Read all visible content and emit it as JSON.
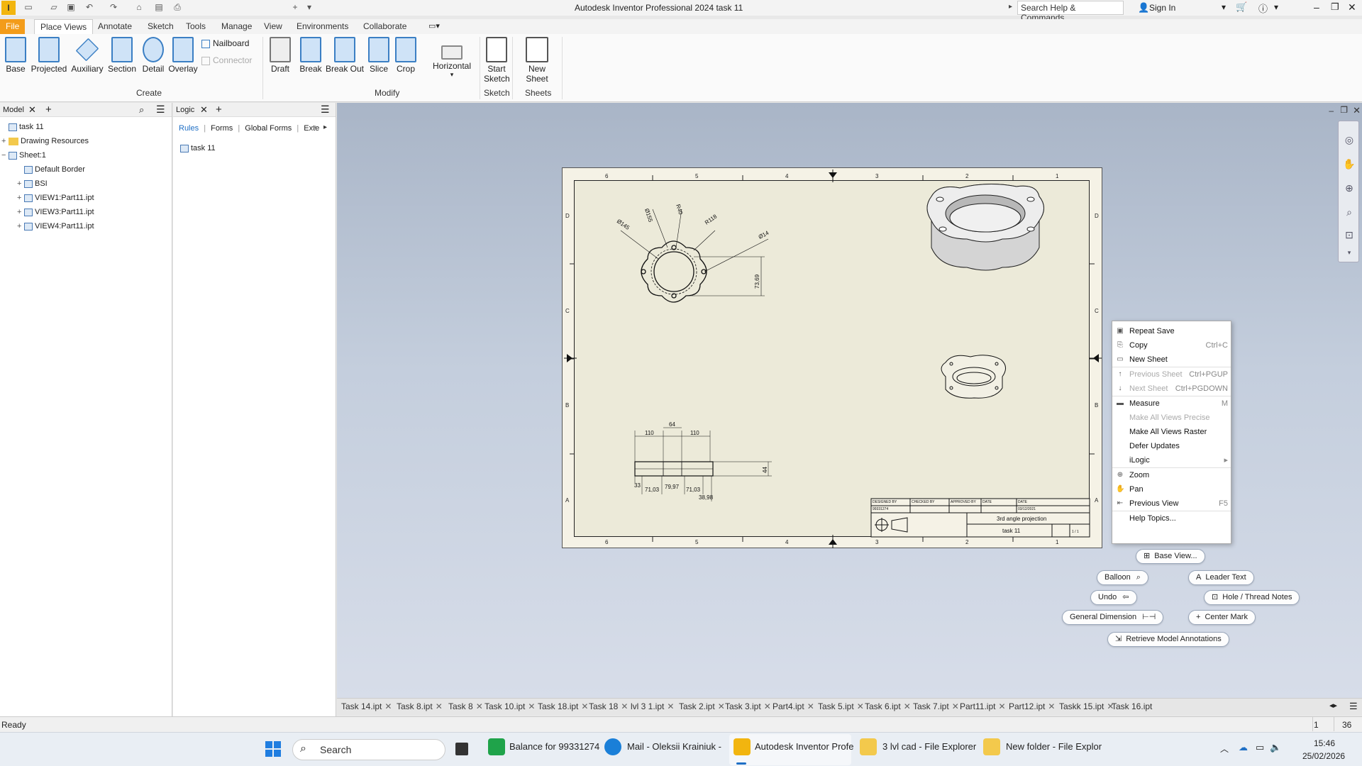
{
  "window": {
    "title": "Autodesk Inventor Professional 2024   task 11",
    "search_placeholder": "Search Help & Commands...",
    "sign_in": "Sign In"
  },
  "ribbon": {
    "tabs": [
      "File",
      "Place Views",
      "Annotate",
      "Sketch",
      "Tools",
      "Manage",
      "View",
      "Environments",
      "Collaborate"
    ],
    "active_tab": "Place Views",
    "create": {
      "label": "Create",
      "buttons": [
        "Base",
        "Projected",
        "Auxiliary",
        "Section",
        "Detail",
        "Overlay"
      ],
      "small": [
        "Nailboard",
        "Connector"
      ]
    },
    "modify": {
      "label": "Modify",
      "buttons": [
        "Draft",
        "Break",
        "Break Out",
        "Slice",
        "Crop",
        "Horizontal"
      ]
    },
    "sketch": {
      "label": "Sketch",
      "button": "Start Sketch"
    },
    "sheets": {
      "label": "Sheets",
      "button": "New Sheet"
    }
  },
  "model_browser": {
    "tab": "Model",
    "items": [
      {
        "label": "task 11",
        "indent": 0,
        "exp": ""
      },
      {
        "label": "Drawing Resources",
        "indent": 0,
        "exp": "+"
      },
      {
        "label": "Sheet:1",
        "indent": 0,
        "exp": "−"
      },
      {
        "label": "Default Border",
        "indent": 1,
        "exp": ""
      },
      {
        "label": "BSI",
        "indent": 1,
        "exp": "+"
      },
      {
        "label": "VIEW1:Part11.ipt",
        "indent": 1,
        "exp": "+"
      },
      {
        "label": "VIEW3:Part11.ipt",
        "indent": 1,
        "exp": "+"
      },
      {
        "label": "VIEW4:Part11.ipt",
        "indent": 1,
        "exp": "+"
      }
    ]
  },
  "logic_browser": {
    "tab": "Logic",
    "subtabs": [
      "Rules",
      "Forms",
      "Global Forms",
      "Exte"
    ],
    "items": [
      "task 11"
    ]
  },
  "drawing": {
    "col_labels": [
      "6",
      "5",
      "4",
      "3",
      "2",
      "1"
    ],
    "row_labels": [
      "D",
      "C",
      "B",
      "A"
    ],
    "dims_top": [
      "Ø155",
      "R40",
      "R118",
      "Ø145",
      "Ø14",
      "73,69"
    ],
    "dims_front": [
      "110",
      "64",
      "110",
      "33",
      "71,03",
      "79,97",
      "71,03",
      "38,98",
      "44"
    ],
    "title_block": {
      "projection": "3rd angle projection",
      "name": "task 11",
      "date": "03/12/2021",
      "sheet": "1 / 1",
      "drawn": "99331274",
      "headers": [
        "DESIGNED BY",
        "CHECKED BY",
        "APPROVED BY",
        "DATE",
        "DATE"
      ]
    }
  },
  "context_menu": {
    "items": [
      {
        "label": "Repeat Save",
        "shortcut": "",
        "disabled": false,
        "icon": "save-icon"
      },
      {
        "label": "Copy",
        "shortcut": "Ctrl+C",
        "disabled": false,
        "icon": "copy-icon"
      },
      {
        "label": "New Sheet",
        "shortcut": "",
        "disabled": false,
        "icon": "new-sheet-icon"
      },
      {
        "label": "Previous Sheet",
        "shortcut": "Ctrl+PGUP",
        "disabled": true,
        "icon": "arrow-up-icon"
      },
      {
        "label": "Next Sheet",
        "shortcut": "Ctrl+PGDOWN",
        "disabled": true,
        "icon": "arrow-down-icon"
      },
      {
        "label": "Measure",
        "shortcut": "M",
        "disabled": false,
        "icon": "measure-icon"
      },
      {
        "label": "Make All Views Precise",
        "shortcut": "",
        "disabled": true,
        "icon": ""
      },
      {
        "label": "Make All Views Raster",
        "shortcut": "",
        "disabled": false,
        "icon": ""
      },
      {
        "label": "Defer Updates",
        "shortcut": "",
        "disabled": false,
        "icon": ""
      },
      {
        "label": "iLogic",
        "shortcut": "▸",
        "disabled": false,
        "icon": ""
      },
      {
        "label": "Zoom",
        "shortcut": "",
        "disabled": false,
        "icon": "zoom-icon"
      },
      {
        "label": "Pan",
        "shortcut": "",
        "disabled": false,
        "icon": "pan-icon"
      },
      {
        "label": "Previous View",
        "shortcut": "F5",
        "disabled": false,
        "icon": "previous-view-icon"
      },
      {
        "label": "Help Topics...",
        "shortcut": "",
        "disabled": false,
        "icon": ""
      }
    ]
  },
  "marking_menu": {
    "base_view": "Base View...",
    "balloon": "Balloon",
    "leader_text": "Leader Text",
    "undo": "Undo",
    "hole_thread": "Hole / Thread Notes",
    "general_dimension": "General Dimension",
    "center_mark": "Center Mark",
    "retrieve": "Retrieve Model Annotations"
  },
  "document_tabs": [
    "Task 14.ipt",
    "Task 8.ipt",
    "Task 8",
    "Task 10.ipt",
    "Task 18.ipt",
    "Task 18",
    "lvl 3 1.ipt",
    "Task 2.ipt",
    "Task 3.ipt",
    "Part4.ipt",
    "Task 5.ipt",
    "Task 6.ipt",
    "Task 7.ipt",
    "Part11.ipt",
    "Part12.ipt",
    "Taskk 15.ipt",
    "Task 16.ipt"
  ],
  "status": {
    "text": "Ready",
    "num1": "1",
    "num2": "36"
  },
  "taskbar": {
    "search": "Search",
    "apps": [
      "Balance for 99331274",
      "Mail - Oleksii Krainiuk -",
      "Autodesk Inventor Profe",
      "3 lvl cad - File Explorer",
      "New folder - File Explor"
    ],
    "time": "15:46",
    "date": "25/02/2026"
  },
  "colors": {
    "accent": "#f39c1a",
    "brand": "#3b7fc4",
    "sheet": "#f5f2e6"
  }
}
